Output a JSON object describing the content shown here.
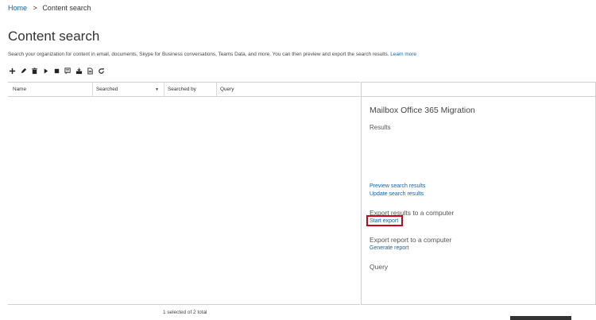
{
  "breadcrumb": {
    "home": "Home",
    "separator": ">",
    "current": "Content search"
  },
  "page_title": "Content search",
  "description": {
    "text": "Search your organization for content in email, documents, Skype for Business conversations, Teams Data, and more. You can then preview and export the search results.",
    "learn_more": "Learn more"
  },
  "toolbar": {
    "icons": [
      "add-icon",
      "edit-icon",
      "delete-icon",
      "start-icon",
      "stop-icon",
      "preview-icon",
      "export-icon",
      "report-icon",
      "refresh-icon"
    ]
  },
  "grid": {
    "columns": [
      "Name",
      "Searched",
      "Searched by",
      "Query"
    ]
  },
  "details": {
    "title": "Mailbox Office 365 Migration",
    "results_label": "Results",
    "preview_link": "Preview search results",
    "update_link": "Update search results",
    "export_results_heading": "Export results to a computer",
    "start_export_link": "Start export",
    "export_report_heading": "Export report to a computer",
    "generate_report_link": "Generate report",
    "query_label": "Query"
  },
  "status": {
    "selection": "1 selected of 2 total"
  },
  "colors": {
    "link": "#0a64b4",
    "highlight": "#d0021b",
    "border": "#d0d0d0"
  }
}
